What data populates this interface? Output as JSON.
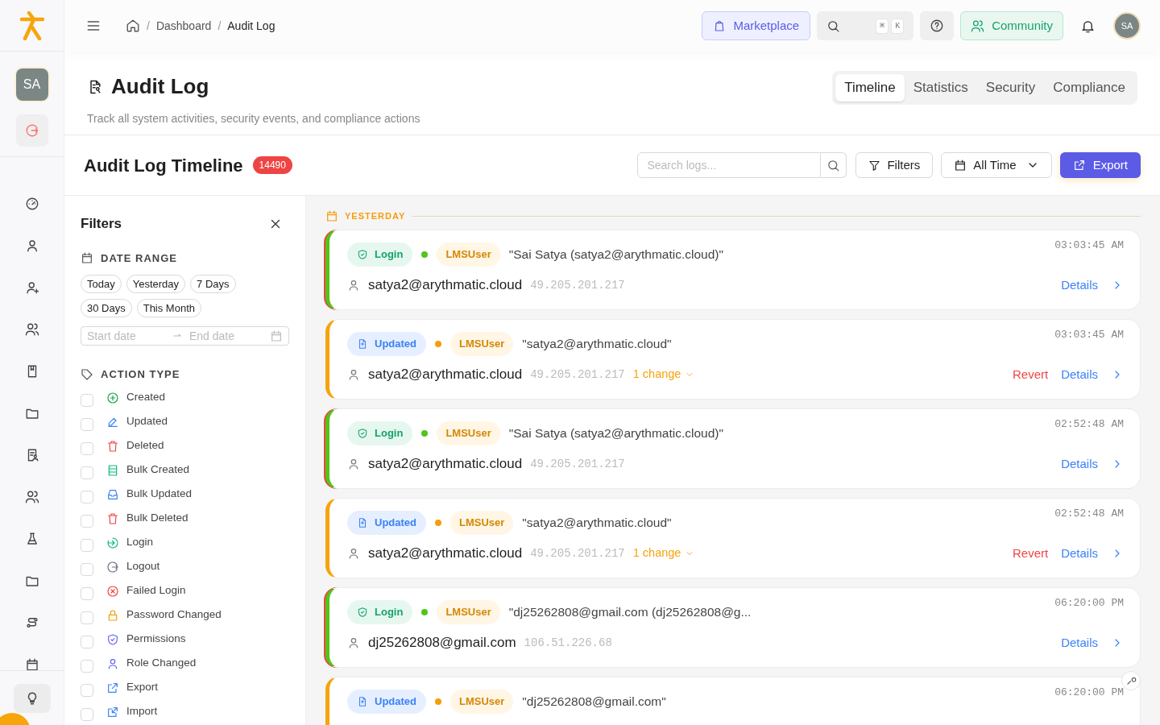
{
  "sidebar": {
    "avatar": "SA"
  },
  "topbar": {
    "breadcrumb": [
      "Dashboard",
      "Audit Log"
    ],
    "breadcrumb_separator": "/",
    "marketplace": "Marketplace",
    "shortcut_keys": [
      "⌘",
      "K"
    ],
    "community": "Community",
    "avatar": "SA"
  },
  "page": {
    "title": "Audit Log",
    "subtitle": "Track all system activities, security events, and compliance actions"
  },
  "tabs": [
    {
      "label": "Timeline",
      "selected": true
    },
    {
      "label": "Statistics",
      "selected": false
    },
    {
      "label": "Security",
      "selected": false
    },
    {
      "label": "Compliance",
      "selected": false
    }
  ],
  "timeline_header": {
    "title": "Audit Log Timeline",
    "count": "14490",
    "search": {
      "placeholder": "Search logs..."
    },
    "filters_button": "Filters",
    "range": "All Time",
    "export_button": "Export"
  },
  "filters": {
    "title": "Filters",
    "date_range": {
      "label": "DATE RANGE",
      "chips": [
        "Today",
        "Yesterday",
        "7 Days",
        "30 Days",
        "This Month"
      ],
      "start_placeholder": "Start date",
      "end_placeholder": "End date"
    },
    "action_type": {
      "label": "ACTION TYPE",
      "items": [
        {
          "kind": "created",
          "label": "Created",
          "checked": false
        },
        {
          "kind": "updated",
          "label": "Updated",
          "checked": false
        },
        {
          "kind": "deleted",
          "label": "Deleted",
          "checked": false
        },
        {
          "kind": "bulk_created",
          "label": "Bulk Created",
          "checked": false
        },
        {
          "kind": "bulk_updated",
          "label": "Bulk Updated",
          "checked": false
        },
        {
          "kind": "bulk_deleted",
          "label": "Bulk Deleted",
          "checked": false
        },
        {
          "kind": "login",
          "label": "Login",
          "checked": false
        },
        {
          "kind": "logout",
          "label": "Logout",
          "checked": false
        },
        {
          "kind": "failed_login",
          "label": "Failed Login",
          "checked": false
        },
        {
          "kind": "password_changed",
          "label": "Password Changed",
          "checked": false
        },
        {
          "kind": "permissions",
          "label": "Permissions",
          "checked": false
        },
        {
          "kind": "role_changed",
          "label": "Role Changed",
          "checked": false
        },
        {
          "kind": "export",
          "label": "Export",
          "checked": false
        },
        {
          "kind": "import",
          "label": "Import",
          "checked": false
        }
      ]
    }
  },
  "timeline": {
    "group": "YESTERDAY",
    "entries": [
      {
        "kind": "login",
        "action": "Login",
        "entity": "LMSUser",
        "description": "\"Sai Satya (satya2@arythmatic.cloud)\"",
        "time": "03:03:45 AM",
        "user": "satya2@arythmatic.cloud",
        "ip": "49.205.201.217",
        "details": "Details"
      },
      {
        "kind": "updated",
        "action": "Updated",
        "entity": "LMSUser",
        "description": "\"satya2@arythmatic.cloud\"",
        "time": "03:03:45 AM",
        "user": "satya2@arythmatic.cloud",
        "ip": "49.205.201.217",
        "changes": "1 change",
        "revert": "Revert",
        "details": "Details"
      },
      {
        "kind": "login",
        "action": "Login",
        "entity": "LMSUser",
        "description": "\"Sai Satya (satya2@arythmatic.cloud)\"",
        "time": "02:52:48 AM",
        "user": "satya2@arythmatic.cloud",
        "ip": "49.205.201.217",
        "details": "Details"
      },
      {
        "kind": "updated",
        "action": "Updated",
        "entity": "LMSUser",
        "description": "\"satya2@arythmatic.cloud\"",
        "time": "02:52:48 AM",
        "user": "satya2@arythmatic.cloud",
        "ip": "49.205.201.217",
        "changes": "1 change",
        "revert": "Revert",
        "details": "Details"
      },
      {
        "kind": "login",
        "action": "Login",
        "entity": "LMSUser",
        "description": "\"dj25262808@gmail.com (dj25262808@g...",
        "time": "06:20:00 PM",
        "user": "dj25262808@gmail.com",
        "ip": "106.51.226.68",
        "details": "Details"
      },
      {
        "kind": "updated",
        "action": "Updated",
        "entity": "LMSUser",
        "description": "\"dj25262808@gmail.com\"",
        "time": "06:20:00 PM"
      }
    ]
  }
}
